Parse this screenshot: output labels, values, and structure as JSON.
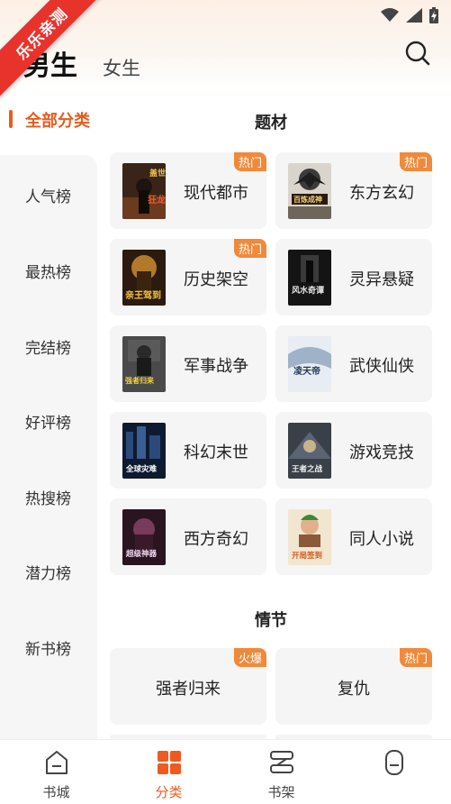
{
  "watermark": "乐乐亲测",
  "header": {
    "tabs": [
      {
        "label": "男生",
        "active": true
      },
      {
        "label": "女生",
        "active": false
      }
    ]
  },
  "sidebar": {
    "selected": "全部分类",
    "items": [
      {
        "label": "人气榜"
      },
      {
        "label": "最热榜"
      },
      {
        "label": "完结榜"
      },
      {
        "label": "好评榜"
      },
      {
        "label": "热搜榜"
      },
      {
        "label": "潜力榜"
      },
      {
        "label": "新书榜"
      }
    ]
  },
  "sections": [
    {
      "title": "题材",
      "cards": [
        {
          "name": "现代都市",
          "badge": "热门",
          "cover_text": "盖世狂龙"
        },
        {
          "name": "东方玄幻",
          "badge": "热门",
          "cover_text": "百炼成神"
        },
        {
          "name": "历史架空",
          "badge": "热门",
          "cover_text": "亲王驾到"
        },
        {
          "name": "灵异悬疑",
          "badge": "",
          "cover_text": "风水奇谭"
        },
        {
          "name": "军事战争",
          "badge": "",
          "cover_text": "强者归来"
        },
        {
          "name": "武侠仙侠",
          "badge": "",
          "cover_text": "凌天帝"
        },
        {
          "name": "科幻末世",
          "badge": "",
          "cover_text": "全球灾难"
        },
        {
          "name": "游戏竞技",
          "badge": "",
          "cover_text": "王者之战"
        },
        {
          "name": "西方奇幻",
          "badge": "",
          "cover_text": "超级神器"
        },
        {
          "name": "同人小说",
          "badge": "",
          "cover_text": "开局签到"
        }
      ]
    },
    {
      "title": "情节",
      "cards": [
        {
          "name": "强者归来",
          "badge": "火爆"
        },
        {
          "name": "复仇",
          "badge": "热门"
        }
      ]
    }
  ],
  "bottom_nav": [
    {
      "label": "书城",
      "icon": "bookstore-icon",
      "active": false
    },
    {
      "label": "分类",
      "icon": "category-icon",
      "active": true
    },
    {
      "label": "书架",
      "icon": "bookshelf-icon",
      "active": false
    },
    {
      "label": "",
      "icon": "profile-icon",
      "active": false
    }
  ],
  "colors": {
    "accent": "#ef5a1f",
    "badge": "#f08a3a",
    "ribbon": "#e8332c"
  }
}
